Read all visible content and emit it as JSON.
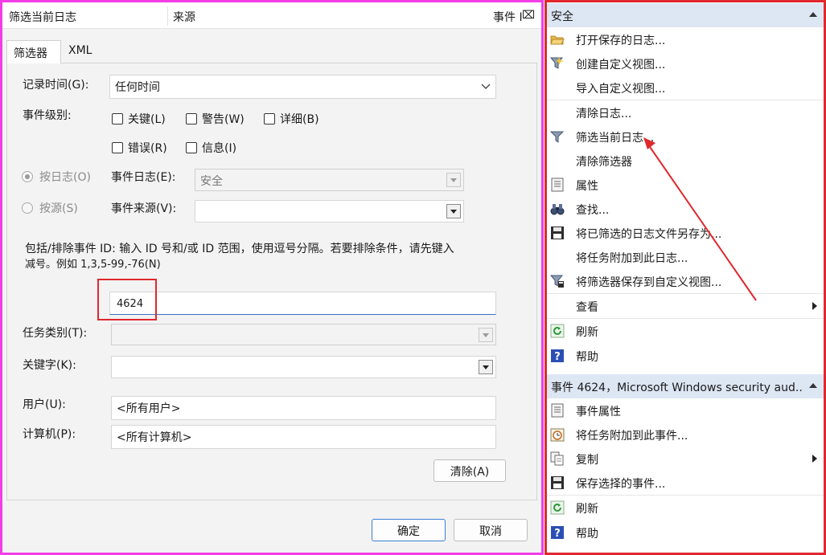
{
  "dialog": {
    "header": {
      "col1": "筛选当前日志",
      "col2": "来源",
      "col3": "事件 ID"
    },
    "tabs": [
      {
        "label": "筛选器",
        "active": true
      },
      {
        "label": "XML",
        "active": false
      }
    ],
    "logged": {
      "label": "记录时间(G):",
      "value": "任何时间"
    },
    "event_level": {
      "label": "事件级别:",
      "options": [
        "关键(L)",
        "警告(W)",
        "详细(B)",
        "错误(R)",
        "信息(I)"
      ]
    },
    "by_log": {
      "radio_label": "按日志(O)",
      "field_label": "事件日志(E):",
      "value": "安全"
    },
    "by_source": {
      "radio_label": "按源(S)",
      "field_label": "事件来源(V):",
      "value": ""
    },
    "id_desc_1": "包括/排除事件 ID: 输入 ID 号和/或 ID 范围，使用逗号分隔。若要排除条件，请先键入",
    "id_desc_2": "减号。例如 1,3,5-99,-76(N)",
    "event_id_value": "4624",
    "task_category": {
      "label": "任务类别(T):",
      "value": ""
    },
    "keywords": {
      "label": "关键字(K):",
      "value": ""
    },
    "user": {
      "label": "用户(U):",
      "value": "<所有用户>"
    },
    "computer": {
      "label": "计算机(P):",
      "value": "<所有计算机>"
    },
    "clear_button": "清除(A)",
    "ok_button": "确定",
    "cancel_button": "取消"
  },
  "actions": {
    "section1": {
      "title": "安全",
      "items": [
        {
          "label": "打开保存的日志...",
          "icon": "folder-open-icon"
        },
        {
          "label": "创建自定义视图...",
          "icon": "filter-create-icon"
        },
        {
          "label": "导入自定义视图...",
          "icon": ""
        },
        {
          "label": "清除日志...",
          "icon": ""
        },
        {
          "label": "筛选当前日志...",
          "icon": "filter-icon"
        },
        {
          "label": "清除筛选器",
          "icon": ""
        },
        {
          "label": "属性",
          "icon": "properties-icon"
        },
        {
          "label": "查找...",
          "icon": "binoculars-icon"
        },
        {
          "label": "将已筛选的日志文件另存为...",
          "icon": "save-icon"
        },
        {
          "label": "将任务附加到此日志...",
          "icon": ""
        },
        {
          "label": "将筛选器保存到自定义视图...",
          "icon": "filter-save-icon"
        },
        {
          "label": "查看",
          "icon": ""
        },
        {
          "label": "刷新",
          "icon": "refresh-icon"
        },
        {
          "label": "帮助",
          "icon": "help-icon"
        }
      ]
    },
    "section2": {
      "title": "事件 4624，Microsoft Windows security aud...",
      "items": [
        {
          "label": "事件属性",
          "icon": "properties-icon"
        },
        {
          "label": "将任务附加到此事件...",
          "icon": "task-clock-icon"
        },
        {
          "label": "复制",
          "icon": "copy-icon"
        },
        {
          "label": "保存选择的事件...",
          "icon": "save-icon"
        },
        {
          "label": "刷新",
          "icon": "refresh-icon"
        },
        {
          "label": "帮助",
          "icon": "help-icon"
        }
      ]
    }
  },
  "colors": {
    "highlight_border": "#e0282e",
    "dialog_border": "#f23ee6",
    "section_header": "#dde6f3"
  }
}
